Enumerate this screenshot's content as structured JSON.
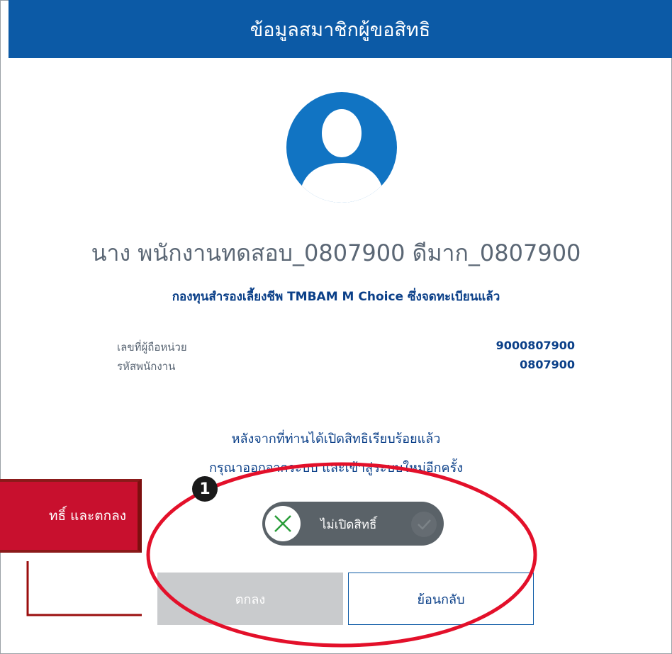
{
  "header": {
    "title": "ข้อมูลสมาชิกผู้ขอสิทธิ"
  },
  "member": {
    "name": "นาง พนักงานทดสอบ_0807900 ดีมาก_0807900",
    "fund": "กองทุนสำรองเลี้ยงชีพ TMBAM M Choice ซึ่งจดทะเบียนแล้ว",
    "unit_holder_label": "เลขที่ผู้ถือหน่วย",
    "unit_holder_value": "9000807900",
    "employee_id_label": "รหัสพนักงาน",
    "employee_id_value": "0807900"
  },
  "note": {
    "line1": "หลังจากที่ท่านได้เปิดสิทธิเรียบร้อยแล้ว",
    "line2": "กรุณาออกจากระบบ และเข้าสู่ระบบใหม่อีกครั้ง"
  },
  "toggle": {
    "label": "ไม่เปิดสิทธิ์",
    "state": "off"
  },
  "buttons": {
    "ok": "ตกลง",
    "back": "ย้อนกลับ"
  },
  "annotation": {
    "callout": "ทธิ์ และตกลง",
    "step": "1"
  },
  "colors": {
    "header": "#0c5aa6",
    "accent_red": "#c8102e",
    "text_blue": "#0a3f88"
  }
}
